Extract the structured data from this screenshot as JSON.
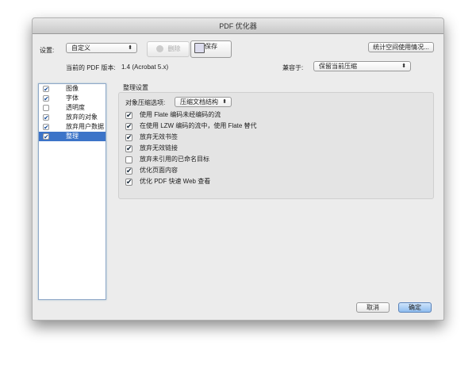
{
  "window": {
    "title": "PDF 优化器"
  },
  "toolbar": {
    "settings_label": "设置:",
    "settings_value": "自定义",
    "delete_label": "删除",
    "save_label": "保存",
    "audit_label": "统计空间使用情况..."
  },
  "info": {
    "version_label": "当前的 PDF 版本:",
    "version_value": "1.4 (Acrobat 5.x)",
    "compat_label": "兼容于:",
    "compat_value": "保留当前压缩"
  },
  "sidebar": {
    "items": [
      {
        "label": "图像",
        "checked": true
      },
      {
        "label": "字体",
        "checked": true
      },
      {
        "label": "透明度",
        "checked": false
      },
      {
        "label": "放弃的对象",
        "checked": true
      },
      {
        "label": "放弃用户数据",
        "checked": true
      },
      {
        "label": "整理",
        "checked": true,
        "selected": true
      }
    ]
  },
  "panel": {
    "title": "整理设置",
    "compress_label": "对象压缩选项:",
    "compress_value": "压缩文档结构",
    "options": [
      {
        "label": "使用 Flate 编码未经编码的流",
        "checked": true
      },
      {
        "label": "在使用 LZW 编码的流中，使用 Flate 替代",
        "checked": true
      },
      {
        "label": "放弃无效书签",
        "checked": true
      },
      {
        "label": "放弃无效链接",
        "checked": true
      },
      {
        "label": "放弃未引用的已命名目标",
        "checked": false
      },
      {
        "label": "优化页面内容",
        "checked": true
      },
      {
        "label": "优化 PDF 快速 Web 查看",
        "checked": true
      }
    ]
  },
  "footer": {
    "cancel_label": "取消",
    "ok_label": "确定"
  }
}
